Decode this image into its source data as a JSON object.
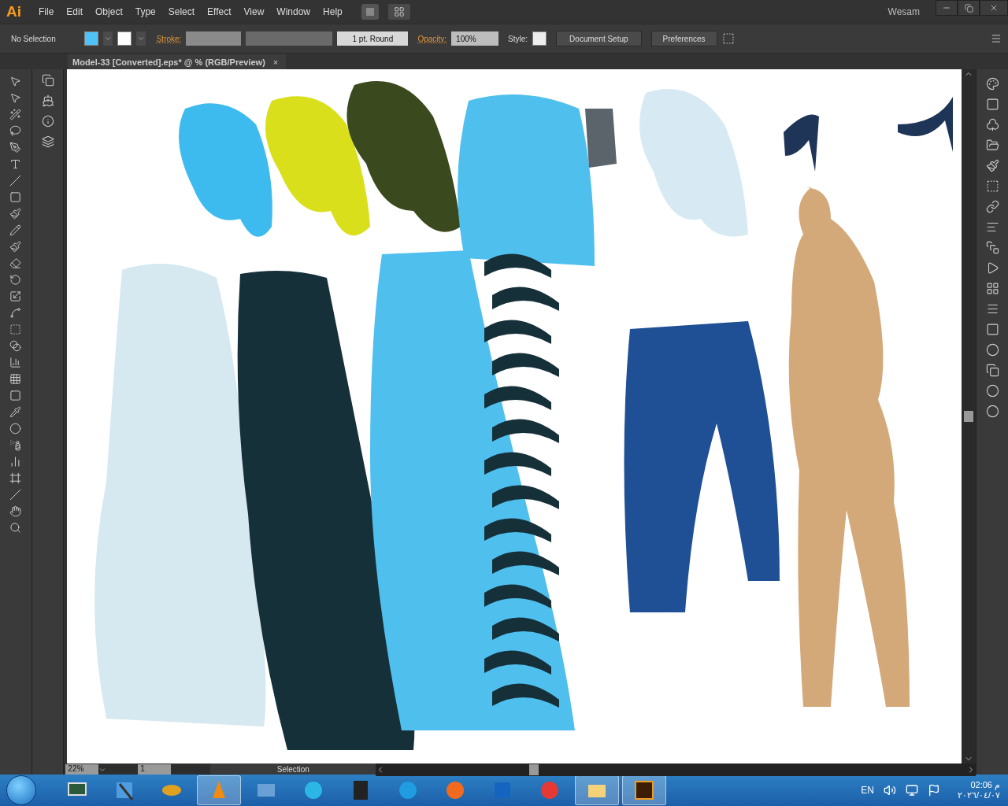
{
  "app_logo": "Ai",
  "menu": [
    "File",
    "Edit",
    "Object",
    "Type",
    "Select",
    "Effect",
    "View",
    "Window",
    "Help"
  ],
  "workspace": {
    "user": "Wesam"
  },
  "control_bar": {
    "selection": "No Selection",
    "stroke_label": "Stroke:",
    "brush": "1 pt. Round",
    "opacity_label": "Opacity:",
    "opacity": "100%",
    "style_label": "Style:",
    "buttons": [
      "Document Setup",
      "Preferences"
    ]
  },
  "document_tab": {
    "title": "Model-33 [Converted].eps* @ % (RGB/Preview)",
    "close": "×"
  },
  "status_bar": {
    "zoom": "22%",
    "page": "1",
    "tool": "Selection"
  },
  "taskbar": {
    "apps": [
      {
        "kind": "monitor",
        "selected": false
      },
      {
        "kind": "pen",
        "selected": false
      },
      {
        "kind": "eye",
        "selected": false
      },
      {
        "kind": "cone",
        "selected": true
      },
      {
        "kind": "film",
        "selected": false
      },
      {
        "kind": "reel",
        "selected": false
      },
      {
        "kind": "studio",
        "selected": false
      },
      {
        "kind": "edge",
        "selected": false
      },
      {
        "kind": "firefox",
        "selected": false
      },
      {
        "kind": "tile",
        "selected": false
      },
      {
        "kind": "chrome",
        "selected": false
      },
      {
        "kind": "folder",
        "selected": true
      },
      {
        "kind": "illustrator",
        "selected": true
      }
    ],
    "language": "EN",
    "time": "02:06 م",
    "date": "٢٠٢٦/٠٤/٠٧"
  }
}
